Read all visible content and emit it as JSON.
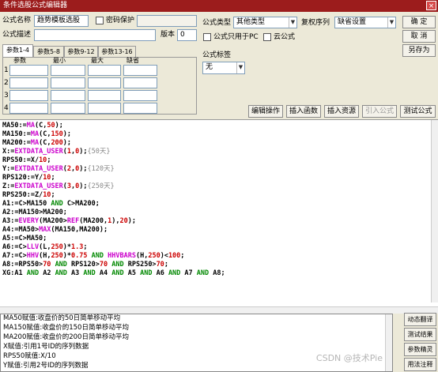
{
  "window": {
    "title": "条件选股公式编辑器",
    "close_glyph": "×"
  },
  "form": {
    "name_label": "公式名称",
    "name_value": "趋势模板选股",
    "password_label": "密码保护",
    "desc_label": "公式描述",
    "version_label": "版本",
    "version_value": "0",
    "type_label": "公式类型",
    "type_value": "其他类型",
    "restore_label": "复权序列",
    "restore_value": "缺省设置",
    "pc_only_label": "公式只用于PC",
    "cloud_label": "云公式",
    "tag_label": "公式标签",
    "tag_value": "无"
  },
  "buttons": {
    "ok": "确 定",
    "cancel": "取 消",
    "save_as": "另存为",
    "edit_op": "编辑操作",
    "insert_func": "插入函数",
    "insert_res": "插入资源",
    "import_formula": "引入公式",
    "test_formula": "测试公式"
  },
  "tabs": [
    "参数1-4",
    "参数5-8",
    "参数9-12",
    "参数13-16"
  ],
  "param_headers": [
    "参数",
    "最小",
    "最大",
    "缺省"
  ],
  "param_rows": [
    "1",
    "2",
    "3",
    "4"
  ],
  "code": [
    [
      [
        "MA50:=",
        "k-black"
      ],
      [
        "MA",
        "k-purple"
      ],
      [
        "(C,",
        "k-black"
      ],
      [
        "50",
        "k-red"
      ],
      [
        ");",
        "k-black"
      ]
    ],
    [
      [
        "MA150:=",
        "k-black"
      ],
      [
        "MA",
        "k-purple"
      ],
      [
        "(C,",
        "k-black"
      ],
      [
        "150",
        "k-red"
      ],
      [
        ");",
        "k-black"
      ]
    ],
    [
      [
        "MA200:=",
        "k-black"
      ],
      [
        "MA",
        "k-purple"
      ],
      [
        "(C,",
        "k-black"
      ],
      [
        "200",
        "k-red"
      ],
      [
        ");",
        "k-black"
      ]
    ],
    [
      [
        "X:=",
        "k-black"
      ],
      [
        "EXTDATA_USER",
        "k-purple"
      ],
      [
        "(",
        "k-black"
      ],
      [
        "1",
        "k-red"
      ],
      [
        ",",
        "k-black"
      ],
      [
        "0",
        "k-red"
      ],
      [
        ");",
        "k-black"
      ],
      [
        "{50天}",
        "k-gray"
      ]
    ],
    [
      [
        "RPS50:=X/",
        "k-black"
      ],
      [
        "10",
        "k-red"
      ],
      [
        ";",
        "k-black"
      ]
    ],
    [
      [
        "Y:=",
        "k-black"
      ],
      [
        "EXTDATA_USER",
        "k-purple"
      ],
      [
        "(",
        "k-black"
      ],
      [
        "2",
        "k-red"
      ],
      [
        ",",
        "k-black"
      ],
      [
        "0",
        "k-red"
      ],
      [
        ");",
        "k-black"
      ],
      [
        "{120天}",
        "k-gray"
      ]
    ],
    [
      [
        "RPS120:=Y/",
        "k-black"
      ],
      [
        "10",
        "k-red"
      ],
      [
        ";",
        "k-black"
      ]
    ],
    [
      [
        "Z:=",
        "k-black"
      ],
      [
        "EXTDATA_USER",
        "k-purple"
      ],
      [
        "(",
        "k-black"
      ],
      [
        "3",
        "k-red"
      ],
      [
        ",",
        "k-black"
      ],
      [
        "0",
        "k-red"
      ],
      [
        ");",
        "k-black"
      ],
      [
        "{250天}",
        "k-gray"
      ]
    ],
    [
      [
        "RPS250:=Z/",
        "k-black"
      ],
      [
        "10",
        "k-red"
      ],
      [
        ";",
        "k-black"
      ]
    ],
    [
      [
        "A1:=C>MA150 ",
        "k-black"
      ],
      [
        "AND",
        "k-green"
      ],
      [
        " C>MA200;",
        "k-black"
      ]
    ],
    [
      [
        "A2:=MA150>MA200;",
        "k-black"
      ]
    ],
    [
      [
        "A3:=",
        "k-black"
      ],
      [
        "EVERY",
        "k-purple"
      ],
      [
        "(MA200>",
        "k-black"
      ],
      [
        "REF",
        "k-purple"
      ],
      [
        "(MA200,",
        "k-black"
      ],
      [
        "1",
        "k-red"
      ],
      [
        "),",
        "k-black"
      ],
      [
        "20",
        "k-red"
      ],
      [
        ");",
        "k-black"
      ]
    ],
    [
      [
        "A4:=MA50>",
        "k-black"
      ],
      [
        "MAX",
        "k-purple"
      ],
      [
        "(MA150,MA200);",
        "k-black"
      ]
    ],
    [
      [
        "A5:=C>MA50;",
        "k-black"
      ]
    ],
    [
      [
        "A6:=C>",
        "k-black"
      ],
      [
        "LLV",
        "k-purple"
      ],
      [
        "(L,",
        "k-black"
      ],
      [
        "250",
        "k-red"
      ],
      [
        ")*",
        "k-black"
      ],
      [
        "1.3",
        "k-red"
      ],
      [
        ";",
        "k-black"
      ]
    ],
    [
      [
        "A7:=C>",
        "k-black"
      ],
      [
        "HHV",
        "k-purple"
      ],
      [
        "(H,",
        "k-black"
      ],
      [
        "250",
        "k-red"
      ],
      [
        ")*",
        "k-black"
      ],
      [
        "0.75",
        "k-red"
      ],
      [
        " ",
        "k-black"
      ],
      [
        "AND",
        "k-green"
      ],
      [
        " ",
        "k-black"
      ],
      [
        "HHVBARS",
        "k-purple"
      ],
      [
        "(H,",
        "k-black"
      ],
      [
        "250",
        "k-red"
      ],
      [
        ")<",
        "k-black"
      ],
      [
        "100",
        "k-red"
      ],
      [
        ";",
        "k-black"
      ]
    ],
    [
      [
        "A8:=RPS50>",
        "k-black"
      ],
      [
        "70",
        "k-red"
      ],
      [
        " ",
        "k-black"
      ],
      [
        "AND",
        "k-green"
      ],
      [
        " RPS120>",
        "k-black"
      ],
      [
        "70",
        "k-red"
      ],
      [
        " ",
        "k-black"
      ],
      [
        "AND",
        "k-green"
      ],
      [
        " RPS250>",
        "k-black"
      ],
      [
        "70",
        "k-red"
      ],
      [
        ";",
        "k-black"
      ]
    ],
    [
      [
        "XG:A1 ",
        "k-black"
      ],
      [
        "AND",
        "k-green"
      ],
      [
        " A2 ",
        "k-black"
      ],
      [
        "AND",
        "k-green"
      ],
      [
        " A3 ",
        "k-black"
      ],
      [
        "AND",
        "k-green"
      ],
      [
        " A4 ",
        "k-black"
      ],
      [
        "AND",
        "k-green"
      ],
      [
        " A5 ",
        "k-black"
      ],
      [
        "AND",
        "k-green"
      ],
      [
        " A6 ",
        "k-black"
      ],
      [
        "AND",
        "k-green"
      ],
      [
        " A7 ",
        "k-black"
      ],
      [
        "AND",
        "k-green"
      ],
      [
        " A8;",
        "k-black"
      ]
    ]
  ],
  "help_lines": [
    "MA50赋值:收盘价的50日简单移动平均",
    "MA150赋值:收盘价的150日简单移动平均",
    "MA200赋值:收盘价的200日简单移动平均",
    "X赋值:引用1号ID的序列数据",
    "RPS50赋值:X/10",
    "Y赋值:引用2号ID的序列数据"
  ],
  "side_buttons": [
    "动态翻译",
    "测试结果",
    "参数精灵",
    "用法注释"
  ],
  "watermark": "CSDN @技术Pie",
  "colors": {
    "titlebar": "#9c1c1c",
    "function": "#cc00cc",
    "number": "#cc0000",
    "keyword": "#008800",
    "comment": "#888888"
  }
}
